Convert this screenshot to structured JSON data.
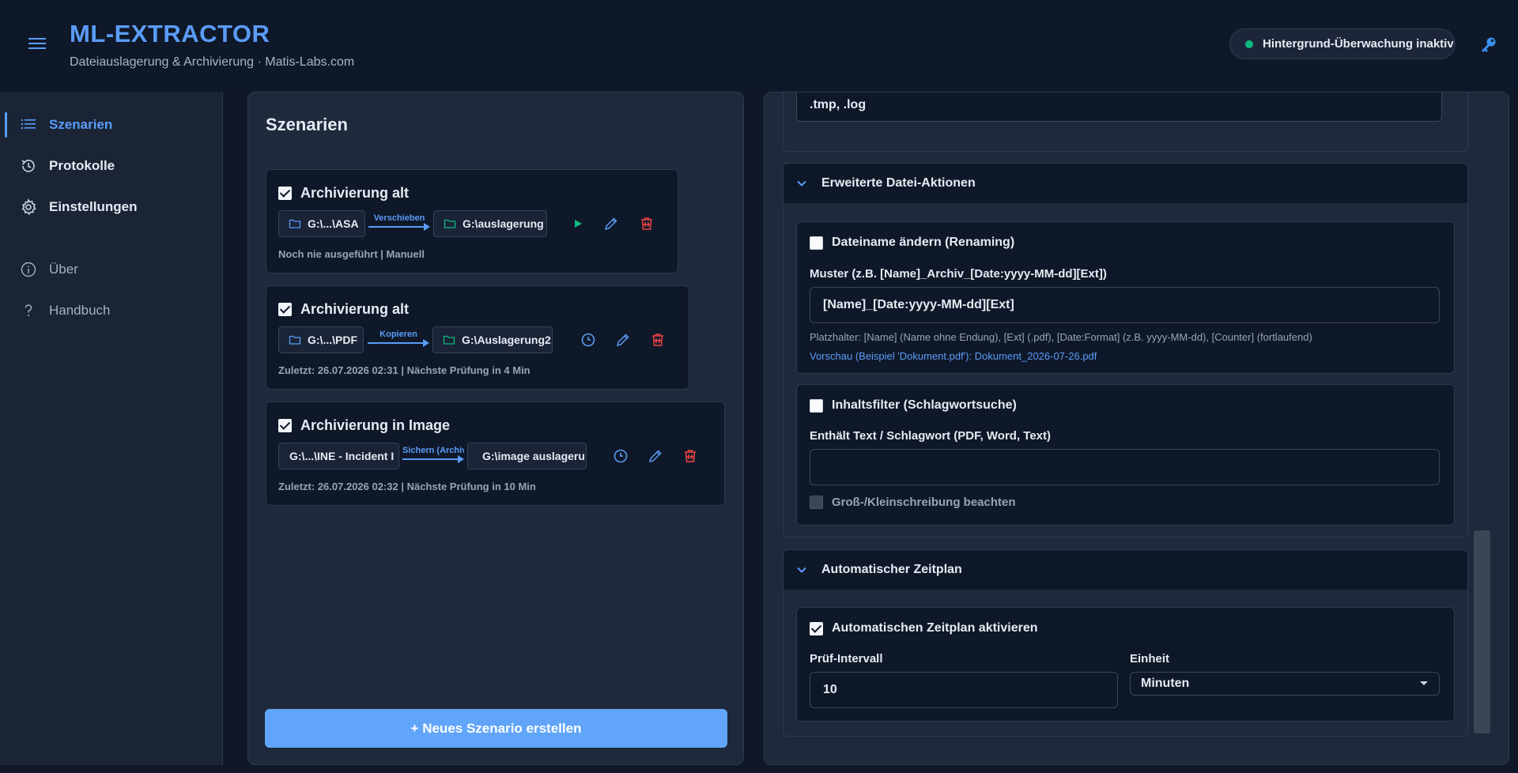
{
  "app": {
    "title": "ML-EXTRACTOR",
    "subtitle": "Dateiauslagerung & Archivierung  ·  Matis-Labs.com",
    "status": "Hintergrund-Überwachung inaktiv"
  },
  "sidebar": {
    "items": [
      {
        "label": "Szenarien",
        "icon": "list-icon",
        "active": true
      },
      {
        "label": "Protokolle",
        "icon": "history-icon"
      },
      {
        "label": "Einstellungen",
        "icon": "gear-icon"
      },
      {
        "label": "Über",
        "icon": "info-icon"
      },
      {
        "label": "Handbuch",
        "icon": "help-icon"
      }
    ]
  },
  "scenarios": {
    "title": "Szenarien",
    "new_button": "+ Neues Szenario erstellen",
    "items": [
      {
        "name": "Archivierung alt",
        "checked": true,
        "source": "G:\\...\\ASA",
        "action": "Verschieben",
        "target": "G:\\auslagerung",
        "meta": "Noch nie ausgeführt | Manuell",
        "mode_icon": "play-icon"
      },
      {
        "name": "Archivierung alt",
        "checked": true,
        "source": "G:\\...\\PDF",
        "action": "Kopieren",
        "target": "G:\\Auslagerung2",
        "meta": "Zuletzt: 26.07.2026 02:31 | Nächste Prüfung in 4 Min",
        "mode_icon": "clock-icon"
      },
      {
        "name": "Archivierung in Image",
        "checked": true,
        "source": "G:\\...\\INE - Incident I",
        "action": "Sichern (Archiv",
        "target": "G:\\image auslageru",
        "meta": "Zuletzt: 26.07.2026 02:32 | Nächste Prüfung in 10 Min",
        "mode_icon": "clock-icon"
      }
    ]
  },
  "editor": {
    "top_field_value": ".tmp, .log",
    "advanced": {
      "title": "Erweiterte Datei-Aktionen",
      "renaming": {
        "label": "Dateiname ändern (Renaming)",
        "checked": false,
        "pattern_label": "Muster (z.B. [Name]_Archiv_[Date:yyyy-MM-dd][Ext])",
        "pattern_value": "[Name]_[Date:yyyy-MM-dd][Ext]",
        "hint": "Platzhalter: [Name] (Name ohne Endung), [Ext] (.pdf), [Date:Format] (z.B. yyyy-MM-dd), [Counter] (fortlaufend)",
        "preview": "Vorschau (Beispiel 'Dokument.pdf'): Dokument_2026-07-26.pdf"
      },
      "content_filter": {
        "label": "Inhaltsfilter (Schlagwortsuche)",
        "checked": false,
        "text_label": "Enthält Text / Schlagwort (PDF, Word, Text)",
        "text_value": "",
        "case_label": "Groß-/Kleinschreibung beachten",
        "case_checked": false
      }
    },
    "schedule": {
      "title": "Automatischer Zeitplan",
      "enable_label": "Automatischen Zeitplan aktivieren",
      "enabled": true,
      "interval_label": "Prüf-Intervall",
      "interval_value": "10",
      "unit_label": "Einheit",
      "unit_value": "Minuten"
    }
  },
  "colors": {
    "accent": "#5a9cf8",
    "success": "#10b981",
    "danger": "#ef4444",
    "background": "#101828",
    "panel": "#1e293b",
    "card": "#0f1828"
  }
}
